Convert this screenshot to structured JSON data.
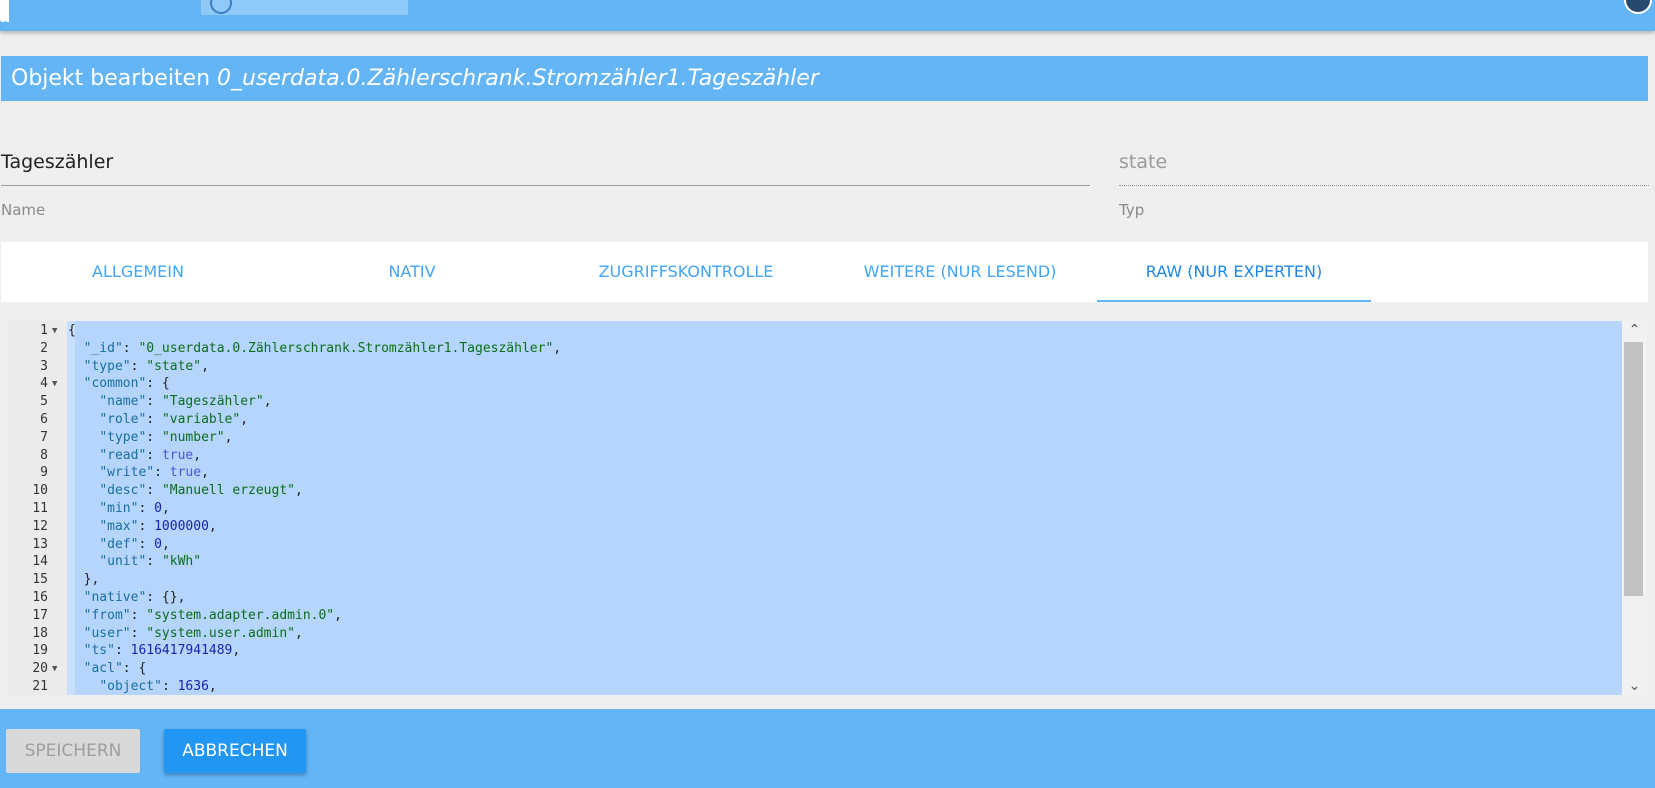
{
  "header": {
    "title_prefix": "Objekt bearbeiten",
    "object_id": "0_userdata.0.Zählerschrank.Stromzähler1.Tageszähler"
  },
  "fields": {
    "name": {
      "value": "Tageszähler",
      "label": "Name"
    },
    "type": {
      "value": "state",
      "label": "Typ"
    }
  },
  "tabs": [
    {
      "label": "ALLGEMEIN"
    },
    {
      "label": "NATIV"
    },
    {
      "label": "ZUGRIFFSKONTROLLE"
    },
    {
      "label": "WEITERE (NUR LESEND)"
    },
    {
      "label": "RAW (NUR EXPERTEN)",
      "active": true
    }
  ],
  "editor": {
    "lines": [
      {
        "num": "1",
        "fold": true,
        "tokens": [
          [
            "p",
            "{"
          ]
        ]
      },
      {
        "num": "2",
        "fold": false,
        "tokens": [
          [
            "p",
            "  "
          ],
          [
            "k",
            "\"_id\""
          ],
          [
            "p",
            ": "
          ],
          [
            "s",
            "\"0_userdata.0.Zählerschrank.Stromzähler1.Tageszähler\""
          ],
          [
            "p",
            ","
          ]
        ]
      },
      {
        "num": "3",
        "fold": false,
        "tokens": [
          [
            "p",
            "  "
          ],
          [
            "k",
            "\"type\""
          ],
          [
            "p",
            ": "
          ],
          [
            "s",
            "\"state\""
          ],
          [
            "p",
            ","
          ]
        ]
      },
      {
        "num": "4",
        "fold": true,
        "tokens": [
          [
            "p",
            "  "
          ],
          [
            "k",
            "\"common\""
          ],
          [
            "p",
            ": {"
          ]
        ]
      },
      {
        "num": "5",
        "fold": false,
        "tokens": [
          [
            "p",
            "    "
          ],
          [
            "k",
            "\"name\""
          ],
          [
            "p",
            ": "
          ],
          [
            "s",
            "\"Tageszähler\""
          ],
          [
            "p",
            ","
          ]
        ]
      },
      {
        "num": "6",
        "fold": false,
        "tokens": [
          [
            "p",
            "    "
          ],
          [
            "k",
            "\"role\""
          ],
          [
            "p",
            ": "
          ],
          [
            "s",
            "\"variable\""
          ],
          [
            "p",
            ","
          ]
        ]
      },
      {
        "num": "7",
        "fold": false,
        "tokens": [
          [
            "p",
            "    "
          ],
          [
            "k",
            "\"type\""
          ],
          [
            "p",
            ": "
          ],
          [
            "s",
            "\"number\""
          ],
          [
            "p",
            ","
          ]
        ]
      },
      {
        "num": "8",
        "fold": false,
        "tokens": [
          [
            "p",
            "    "
          ],
          [
            "k",
            "\"read\""
          ],
          [
            "p",
            ": "
          ],
          [
            "b",
            "true"
          ],
          [
            "p",
            ","
          ]
        ]
      },
      {
        "num": "9",
        "fold": false,
        "tokens": [
          [
            "p",
            "    "
          ],
          [
            "k",
            "\"write\""
          ],
          [
            "p",
            ": "
          ],
          [
            "b",
            "true"
          ],
          [
            "p",
            ","
          ]
        ]
      },
      {
        "num": "10",
        "fold": false,
        "tokens": [
          [
            "p",
            "    "
          ],
          [
            "k",
            "\"desc\""
          ],
          [
            "p",
            ": "
          ],
          [
            "s",
            "\"Manuell erzeugt\""
          ],
          [
            "p",
            ","
          ]
        ]
      },
      {
        "num": "11",
        "fold": false,
        "tokens": [
          [
            "p",
            "    "
          ],
          [
            "k",
            "\"min\""
          ],
          [
            "p",
            ": "
          ],
          [
            "n",
            "0"
          ],
          [
            "p",
            ","
          ]
        ]
      },
      {
        "num": "12",
        "fold": false,
        "tokens": [
          [
            "p",
            "    "
          ],
          [
            "k",
            "\"max\""
          ],
          [
            "p",
            ": "
          ],
          [
            "n",
            "1000000"
          ],
          [
            "p",
            ","
          ]
        ]
      },
      {
        "num": "13",
        "fold": false,
        "tokens": [
          [
            "p",
            "    "
          ],
          [
            "k",
            "\"def\""
          ],
          [
            "p",
            ": "
          ],
          [
            "n",
            "0"
          ],
          [
            "p",
            ","
          ]
        ]
      },
      {
        "num": "14",
        "fold": false,
        "tokens": [
          [
            "p",
            "    "
          ],
          [
            "k",
            "\"unit\""
          ],
          [
            "p",
            ": "
          ],
          [
            "s",
            "\"kWh\""
          ]
        ]
      },
      {
        "num": "15",
        "fold": false,
        "tokens": [
          [
            "p",
            "  },"
          ]
        ]
      },
      {
        "num": "16",
        "fold": false,
        "tokens": [
          [
            "p",
            "  "
          ],
          [
            "k",
            "\"native\""
          ],
          [
            "p",
            ": {},"
          ]
        ]
      },
      {
        "num": "17",
        "fold": false,
        "tokens": [
          [
            "p",
            "  "
          ],
          [
            "k",
            "\"from\""
          ],
          [
            "p",
            ": "
          ],
          [
            "s",
            "\"system.adapter.admin.0\""
          ],
          [
            "p",
            ","
          ]
        ]
      },
      {
        "num": "18",
        "fold": false,
        "tokens": [
          [
            "p",
            "  "
          ],
          [
            "k",
            "\"user\""
          ],
          [
            "p",
            ": "
          ],
          [
            "s",
            "\"system.user.admin\""
          ],
          [
            "p",
            ","
          ]
        ]
      },
      {
        "num": "19",
        "fold": false,
        "tokens": [
          [
            "p",
            "  "
          ],
          [
            "k",
            "\"ts\""
          ],
          [
            "p",
            ": "
          ],
          [
            "n",
            "1616417941489"
          ],
          [
            "p",
            ","
          ]
        ]
      },
      {
        "num": "20",
        "fold": true,
        "tokens": [
          [
            "p",
            "  "
          ],
          [
            "k",
            "\"acl\""
          ],
          [
            "p",
            ": {"
          ]
        ]
      },
      {
        "num": "21",
        "fold": false,
        "tokens": [
          [
            "p",
            "    "
          ],
          [
            "k",
            "\"object\""
          ],
          [
            "p",
            ": "
          ],
          [
            "n",
            "1636"
          ],
          [
            "p",
            ","
          ]
        ]
      }
    ]
  },
  "footer": {
    "save_label": "SPEICHERN",
    "cancel_label": "ABBRECHEN"
  }
}
